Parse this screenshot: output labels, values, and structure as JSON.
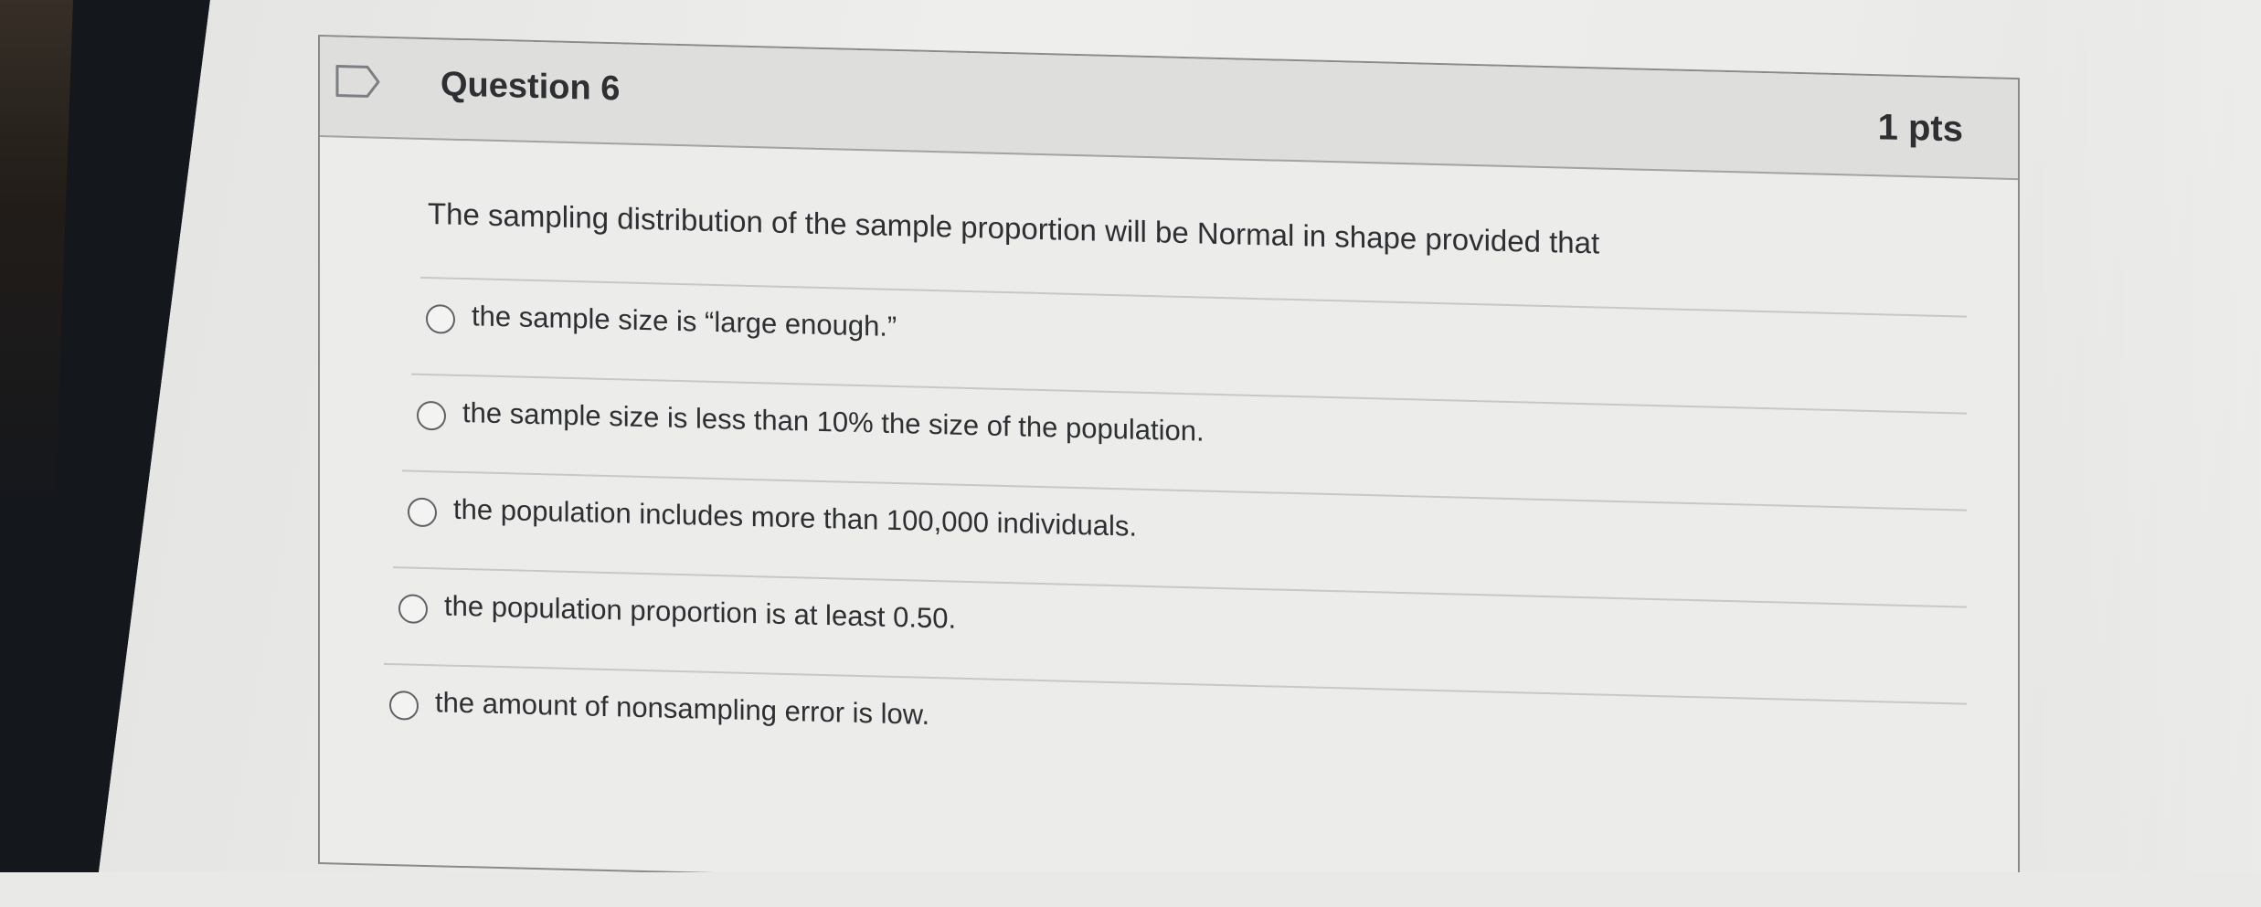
{
  "question": {
    "title": "Question 6",
    "points": "1 pts",
    "prompt": "The sampling distribution of the sample proportion will be Normal in shape provided that",
    "flag_icon": "flag-outline-icon",
    "answers": [
      {
        "label": "the sample size is “large enough.”",
        "selected": false
      },
      {
        "label": "the sample size is less than 10% the size of the population.",
        "selected": false
      },
      {
        "label": "the population includes more than 100,000 individuals.",
        "selected": false
      },
      {
        "label": "the population proportion is at least 0.50.",
        "selected": false
      },
      {
        "label": "the amount of nonsampling error is low.",
        "selected": false
      }
    ]
  }
}
